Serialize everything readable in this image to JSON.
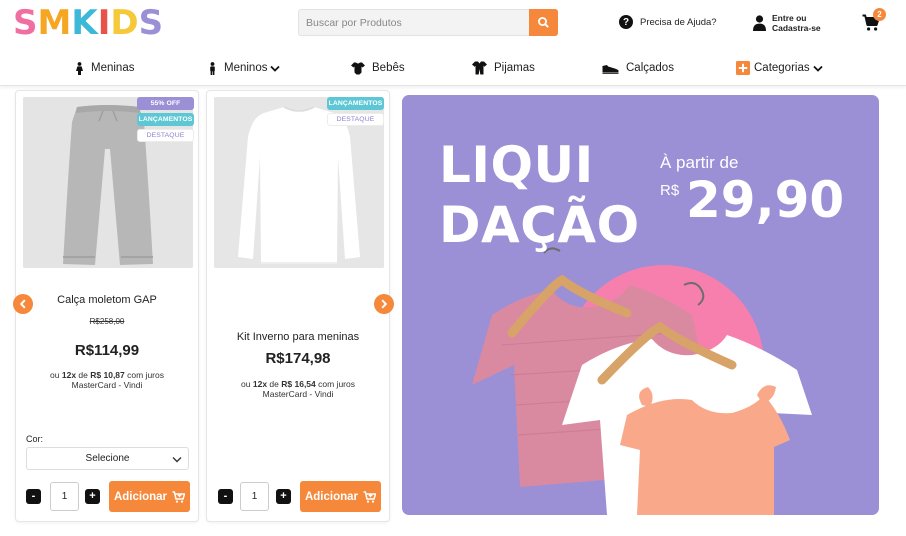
{
  "header": {
    "logo_letters": [
      {
        "char": "S",
        "color": "#f06ea0"
      },
      {
        "char": "M",
        "color": "#f5a623"
      },
      {
        "char": "K",
        "color": "#3cb8d8"
      },
      {
        "char": "I",
        "color": "#e8524a"
      },
      {
        "char": "D",
        "color": "#f5c93a"
      },
      {
        "char": "S",
        "color": "#9b8fd6"
      }
    ],
    "search_placeholder": "Buscar por Produtos",
    "help_label": "Precisa de Ajuda?",
    "account_line1": "Entre ou",
    "account_line2": "Cadastra-se",
    "cart_count": "2"
  },
  "nav": {
    "items": [
      {
        "label": "Meninas",
        "icon": "girl-icon"
      },
      {
        "label": "Meninos",
        "icon": "boy-icon",
        "dropdown": true
      },
      {
        "label": "Bebês",
        "icon": "baby-bodysuit-icon"
      },
      {
        "label": "Pijamas",
        "icon": "pajamas-icon"
      },
      {
        "label": "Calçados",
        "icon": "shoe-icon"
      },
      {
        "label": "Categorias",
        "icon": "plus-square-icon",
        "dropdown": true
      }
    ]
  },
  "products": [
    {
      "tags": [
        "55% OFF",
        "LANÇAMENTOS",
        "DESTAQUE"
      ],
      "name": "Calça moletom GAP",
      "old_price": "R$258,00",
      "price": "R$114,99",
      "installment_prefix": "ou",
      "installment_count": "12x",
      "installment_mid": "de",
      "installment_value": "R$ 10,87",
      "installment_suffix": "com juros",
      "installment_line2": "MasterCard - Vindi",
      "color_label": "Cor:",
      "select_value": "Selecione",
      "qty_minus": "-",
      "qty": "1",
      "qty_plus": "+",
      "add_label": "Adicionar"
    },
    {
      "tags": [
        "LANÇAMENTOS",
        "DESTAQUE"
      ],
      "name": "Kit Inverno para meninas",
      "price": "R$174,98",
      "installment_prefix": "ou",
      "installment_count": "12x",
      "installment_mid": "de",
      "installment_value": "R$ 16,54",
      "installment_suffix": "com juros",
      "installment_line2": "MasterCard - Vindi",
      "qty_minus": "-",
      "qty": "1",
      "qty_plus": "+",
      "add_label": "Adicionar"
    }
  ],
  "banner": {
    "title_line1": "LIQUI",
    "title_line2": "DAÇÃO",
    "from_label": "À partir de",
    "currency": "R$",
    "price": "29,90"
  },
  "colors": {
    "accent_orange": "#f5883a",
    "banner_purple": "#9b8fd6",
    "tag_teal": "#5ec7d6",
    "banner_pink_circle": "#f77fae"
  }
}
